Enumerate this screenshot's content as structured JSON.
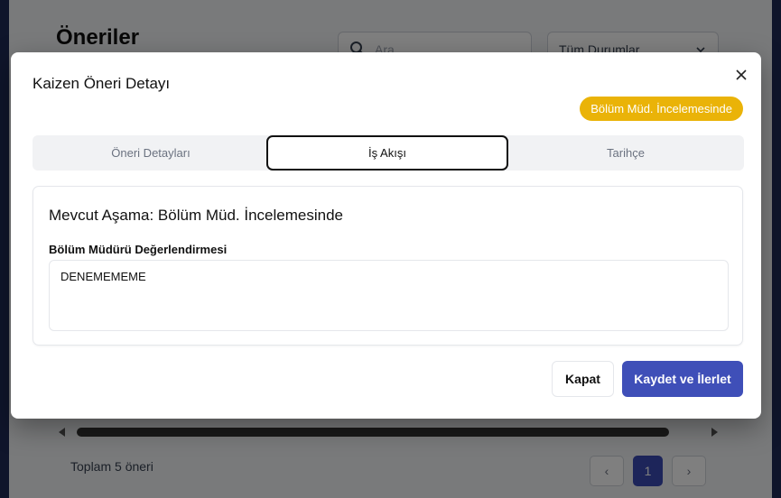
{
  "background": {
    "page_title": "Öneriler",
    "search": {
      "placeholder": "Ara",
      "icon": "search-icon"
    },
    "status_filter": {
      "value": "Tüm Durumlar",
      "icon": "chevron-down-icon"
    },
    "total_text": "Toplam 5 öneri",
    "pagination": {
      "prev": "‹",
      "current_page": "1",
      "next": "›"
    }
  },
  "modal": {
    "title": "Kaizen Öneri Detayı",
    "close_icon": "close-icon",
    "status_badge": "Bölüm Müd. İncelemesinde",
    "tabs": [
      {
        "label": "Öneri Detayları"
      },
      {
        "label": "İş Akışı"
      },
      {
        "label": "Tarihçe"
      }
    ],
    "active_tab": "İş Akışı",
    "stage_title": "Mevcut Aşama: Bölüm Müd. İncelemesinde",
    "evaluation_label": "Bölüm Müdürü Değerlendirmesi",
    "evaluation_value": "DENEMEMEME",
    "buttons": {
      "cancel": "Kapat",
      "submit": "Kaydet ve İlerlet"
    }
  },
  "colors": {
    "badge": "#eab308",
    "primary": "#3f4fb8"
  }
}
